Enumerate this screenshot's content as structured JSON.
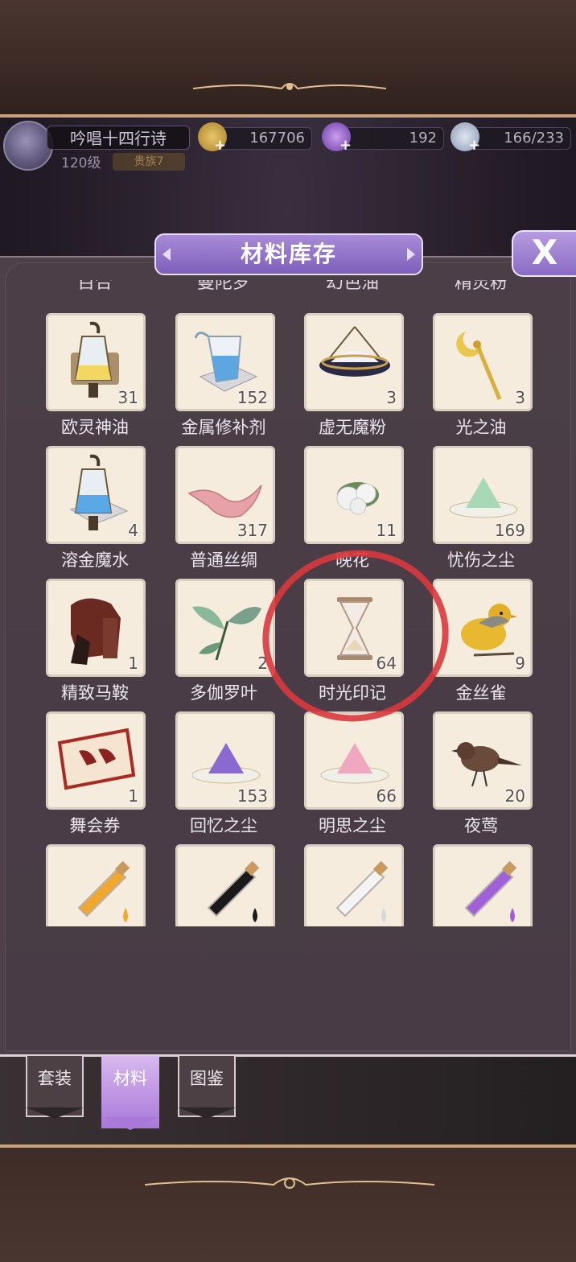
{
  "player": {
    "name": "吟唱十四行诗",
    "level": "120级",
    "rank_badge": "贵族7"
  },
  "resources": {
    "gold": "167706",
    "gems": "192",
    "stamina": "166/233",
    "plus_glyph": "+"
  },
  "panel": {
    "title": "材料库存",
    "close_label": "X"
  },
  "partial_row_labels": [
    "百合",
    "曼陀罗",
    "幻色油",
    "精灵粉"
  ],
  "items": [
    {
      "name": "欧灵神油",
      "qty": "31",
      "icon": "oil-vessel-icon"
    },
    {
      "name": "金属修补剂",
      "qty": "152",
      "icon": "metal-repair-pitcher-icon"
    },
    {
      "name": "虚无魔粉",
      "qty": "3",
      "icon": "void-powder-bowl-icon"
    },
    {
      "name": "光之油",
      "qty": "3",
      "icon": "moon-wand-icon"
    },
    {
      "name": "溶金魔水",
      "qty": "4",
      "icon": "magic-water-vessel-icon"
    },
    {
      "name": "普通丝绸",
      "qty": "317",
      "icon": "silk-ribbon-icon"
    },
    {
      "name": "晚花",
      "qty": "11",
      "icon": "white-rose-icon"
    },
    {
      "name": "忧伤之尘",
      "qty": "169",
      "icon": "green-dust-pile-icon"
    },
    {
      "name": "精致马鞍",
      "qty": "1",
      "icon": "saddle-icon"
    },
    {
      "name": "多伽罗叶",
      "qty": "2",
      "icon": "leaf-sprig-icon"
    },
    {
      "name": "时光印记",
      "qty": "64",
      "icon": "hourglass-icon"
    },
    {
      "name": "金丝雀",
      "qty": "9",
      "icon": "canary-bird-icon"
    },
    {
      "name": "舞会券",
      "qty": "1",
      "icon": "ball-ticket-icon"
    },
    {
      "name": "回忆之尘",
      "qty": "153",
      "icon": "purple-dust-pile-icon"
    },
    {
      "name": "明思之尘",
      "qty": "66",
      "icon": "pink-dust-pile-icon"
    },
    {
      "name": "夜莺",
      "qty": "20",
      "icon": "nightingale-icon"
    }
  ],
  "bottom_row_icons": [
    "orange-vial-icon",
    "black-vial-icon",
    "clear-vial-icon",
    "purple-vial-icon"
  ],
  "tabs": [
    {
      "label": "套装",
      "state": "inactive"
    },
    {
      "label": "材料",
      "state": "active"
    },
    {
      "label": "图鉴",
      "state": "inactive"
    }
  ],
  "colors": {
    "accent_purple": "#8a6bc4",
    "annotation_red": "#d9393d",
    "item_bg": "#f5ecdd"
  }
}
